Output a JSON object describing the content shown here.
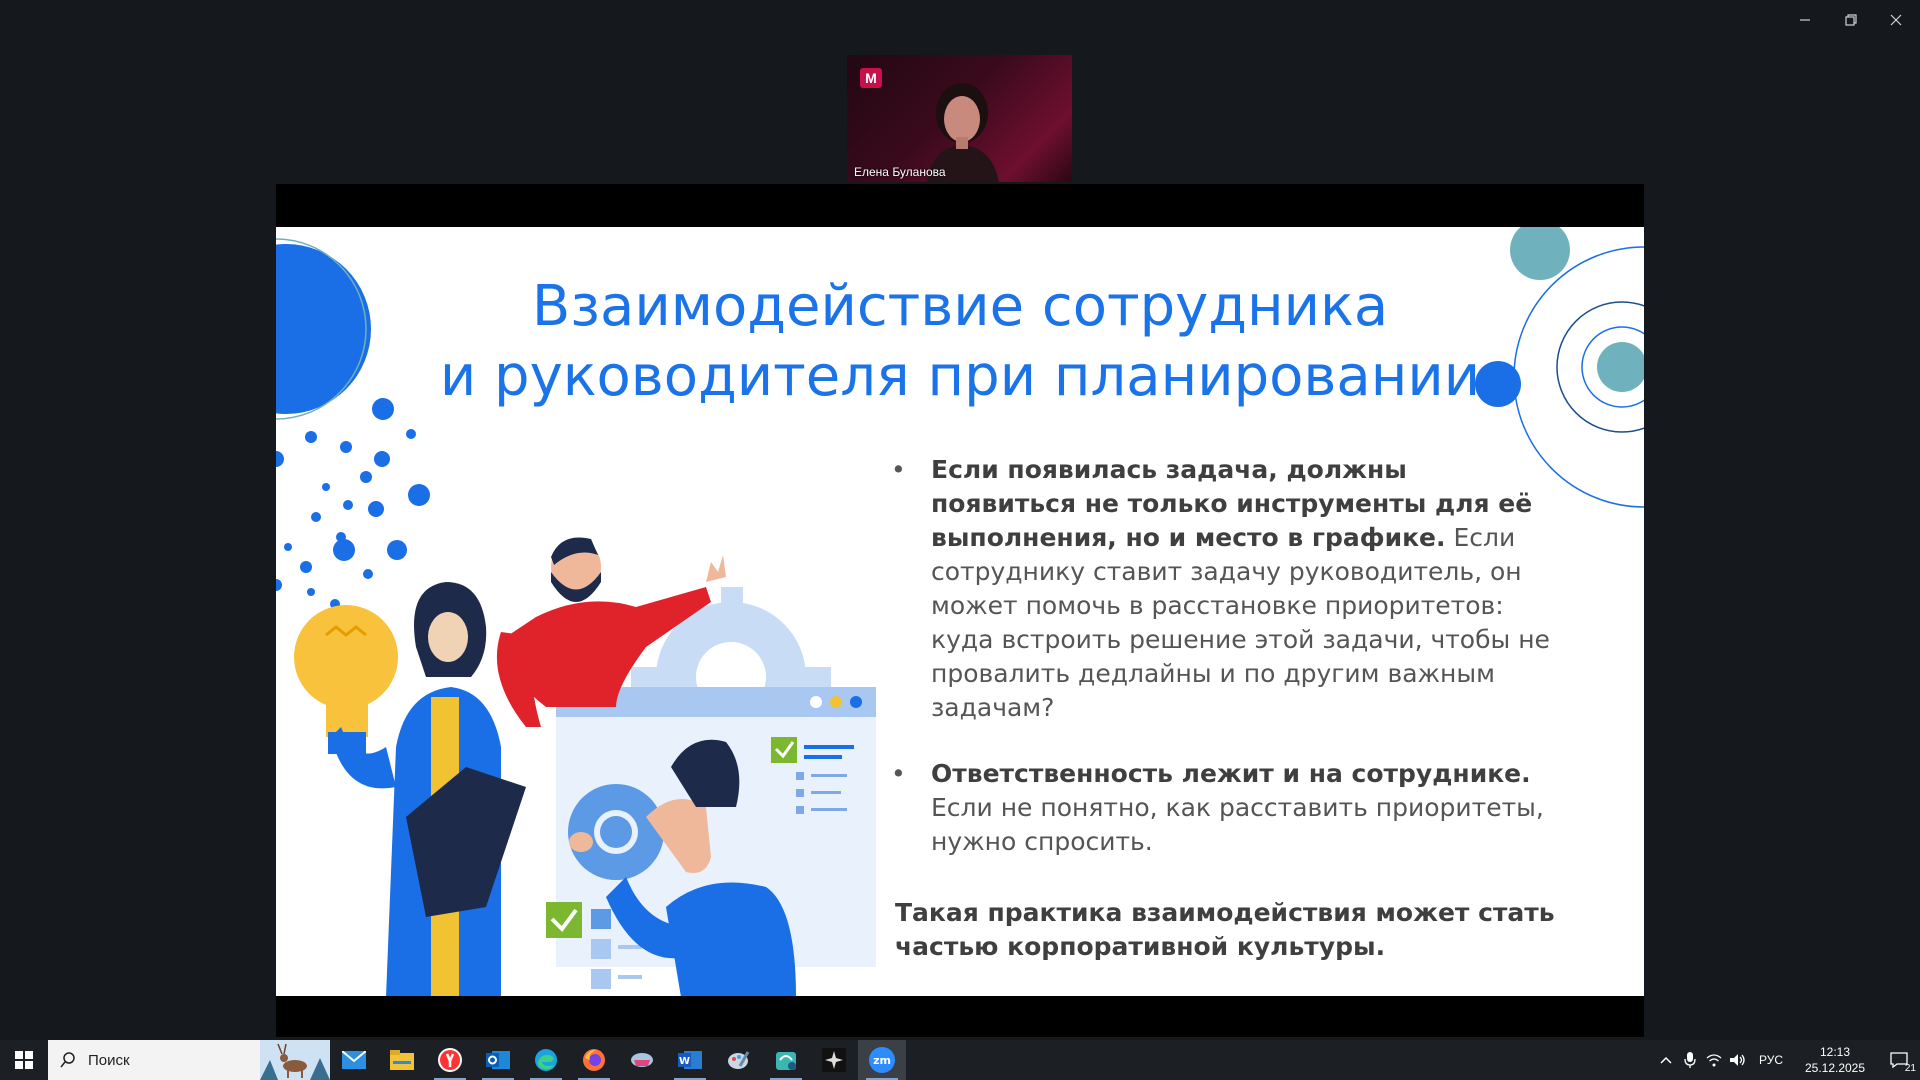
{
  "window": {
    "controls": [
      "minimize-icon",
      "restore-icon",
      "close-icon"
    ]
  },
  "video": {
    "participant_name": "Елена Буланова",
    "logo_letter": "М"
  },
  "slide": {
    "title_line1": "Взаимодействие сотрудника",
    "title_line2": "и руководителя при планировании",
    "bullet1_bold": "Если появилась задача, должны появиться не только инструменты для её выполнения, но и место в графике.",
    "bullet1_text": "Если сотруднику ставит задачу руководитель, он может помочь в расстановке приоритетов: куда встроить решение этой задачи, чтобы не провалить дедлайны и по другим важным задачам?",
    "bullet2_bold": "Ответственность лежит и на сотруднике.",
    "bullet2_text": "Если не понятно, как расставить приоритеты, нужно спросить.",
    "conclusion": "Такая практика взаимодействия может стать частью корпоративной культуры.",
    "accent_color": "#1a73e8",
    "teal_color": "#6fb2bd"
  },
  "taskbar": {
    "search_placeholder": "Поиск",
    "apps": [
      "mail-icon",
      "file-explorer-icon",
      "yandex-browser-icon",
      "outlook-icon",
      "edge-icon",
      "firefox-icon",
      "cloud-app-icon",
      "word-icon",
      "paint-app-icon",
      "store-app-icon",
      "dark-app-icon",
      "zoom-icon"
    ],
    "zoom_label": "zm",
    "language": "РУС",
    "time": "12:13",
    "date": "25.12.2025",
    "notifications_count": "21"
  }
}
